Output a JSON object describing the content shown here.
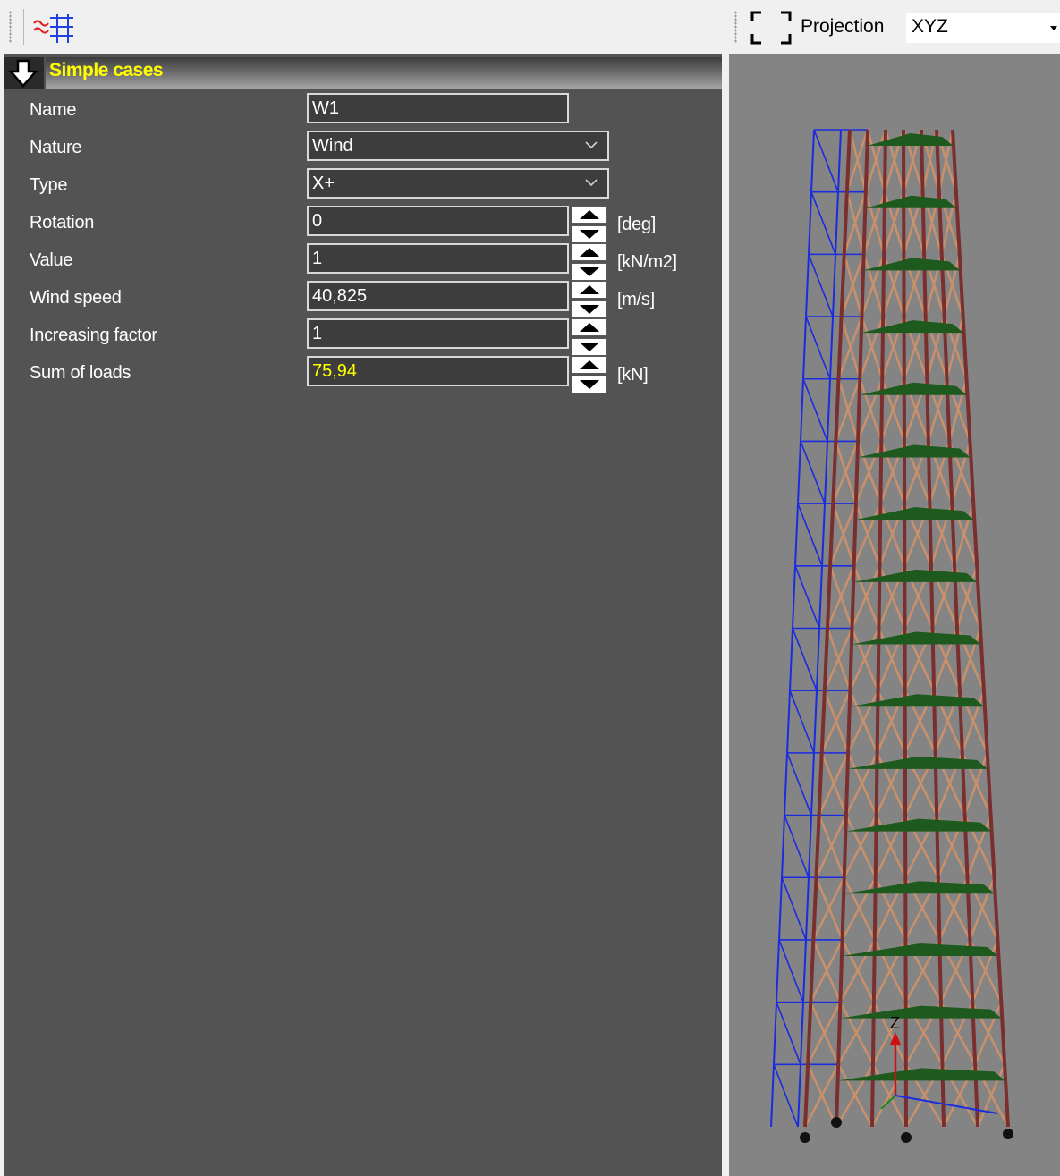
{
  "toolbar": {
    "tool_icon": "wind-load-generator-icon"
  },
  "section": {
    "title": "Simple cases"
  },
  "fields": {
    "name": {
      "label": "Name",
      "value": "W1"
    },
    "nature": {
      "label": "Nature",
      "value": "Wind"
    },
    "type": {
      "label": "Type",
      "value": "X+"
    },
    "rotation": {
      "label": "Rotation",
      "value": "0",
      "unit": "[deg]"
    },
    "value": {
      "label": "Value",
      "value": "1",
      "unit": "[kN/m2]"
    },
    "wind_speed": {
      "label": "Wind speed",
      "value": "40,825",
      "unit": "[m/s]"
    },
    "increasing_factor": {
      "label": "Increasing factor",
      "value": "1"
    },
    "sum_of_loads": {
      "label": "Sum of loads",
      "value": "75,94",
      "unit": "[kN]",
      "value_color": "#ffff00"
    }
  },
  "view": {
    "projection_label": "Projection",
    "projection_value": "XYZ",
    "axis_label": "Z",
    "colors": {
      "background": "#848484",
      "bracing": "#c9916b",
      "columns": "#7a2e2e",
      "wind_arrows": "#1e5a1e",
      "side_frame": "#1a2be0"
    }
  }
}
